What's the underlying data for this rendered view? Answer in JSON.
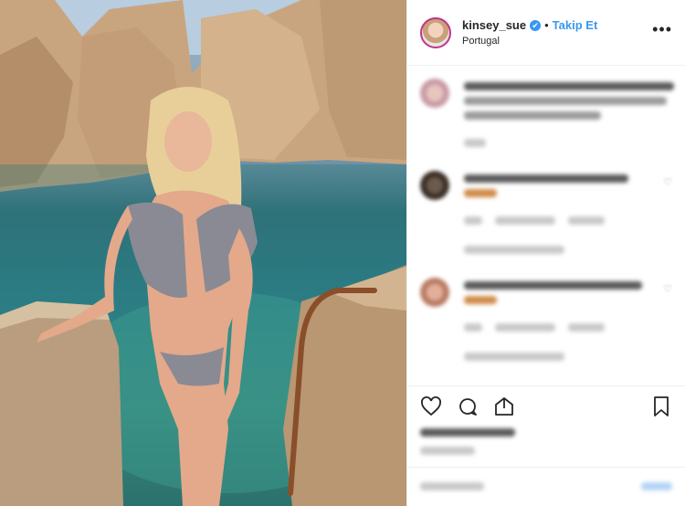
{
  "post": {
    "username": "kinsey_sue",
    "verified_badge": "✔",
    "separator": "•",
    "follow_label": "Takip Et",
    "location": "Portugal",
    "more_label": "•••"
  },
  "colors": {
    "follow": "#3897f0",
    "text": "#262626",
    "border": "#efefef"
  },
  "icons": [
    "like-icon",
    "comment-icon",
    "share-icon",
    "bookmark-icon",
    "more-options-icon"
  ]
}
